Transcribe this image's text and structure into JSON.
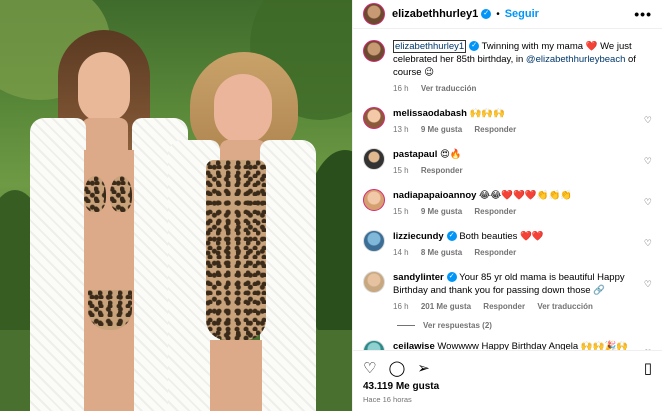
{
  "post": {
    "username": "elizabethhurley1",
    "follow_label": "Seguir",
    "caption_user": "elizabethhurley1",
    "caption_text_1": "Twinning with my mama ❤️ We just celebrated her 85th birthday, in ",
    "caption_mention": "@elizabethhurleybeach",
    "caption_text_2": " of course 😉",
    "caption_time": "16 h",
    "caption_translate": "Ver traducción"
  },
  "comments": [
    {
      "user": "melissaodabash",
      "text": "🙌🙌🙌",
      "time": "13 h",
      "likes": "9 Me gusta",
      "reply": "Responder"
    },
    {
      "user": "pastapaul",
      "text": "😍🔥",
      "time": "15 h",
      "reply": "Responder"
    },
    {
      "user": "nadiapapaioannoy",
      "text": "😂😂❤️❤️❤️👏👏👏",
      "time": "15 h",
      "likes": "9 Me gusta",
      "reply": "Responder"
    },
    {
      "user": "lizziecundy",
      "text": "Both beauties ❤️❤️",
      "time": "14 h",
      "likes": "8 Me gusta",
      "reply": "Responder"
    },
    {
      "user": "sandylinter",
      "text": "Your 85 yr old mama is beautiful Happy Birthday and thank you for passing down those 🔗",
      "time": "16 h",
      "likes": "201 Me gusta",
      "reply": "Responder",
      "translate": "Ver traducción"
    },
    {
      "user": "ceilawise",
      "text": "Wowwww Happy Birthday Angela 🙌🙌🎉🙌🙌 you are ❤️Amazinggg ❤️",
      "time": "",
      "reply": ""
    }
  ],
  "replies_label": "Ver respuestas (2)",
  "footer": {
    "likes": "43.119 Me gusta",
    "time": "Hace 16 horas"
  },
  "icons": {
    "like": "heart-icon",
    "comment": "comment-icon",
    "share": "share-icon",
    "save": "bookmark-icon"
  },
  "colors": {
    "accent": "#0095f6",
    "meta": "#737373"
  }
}
